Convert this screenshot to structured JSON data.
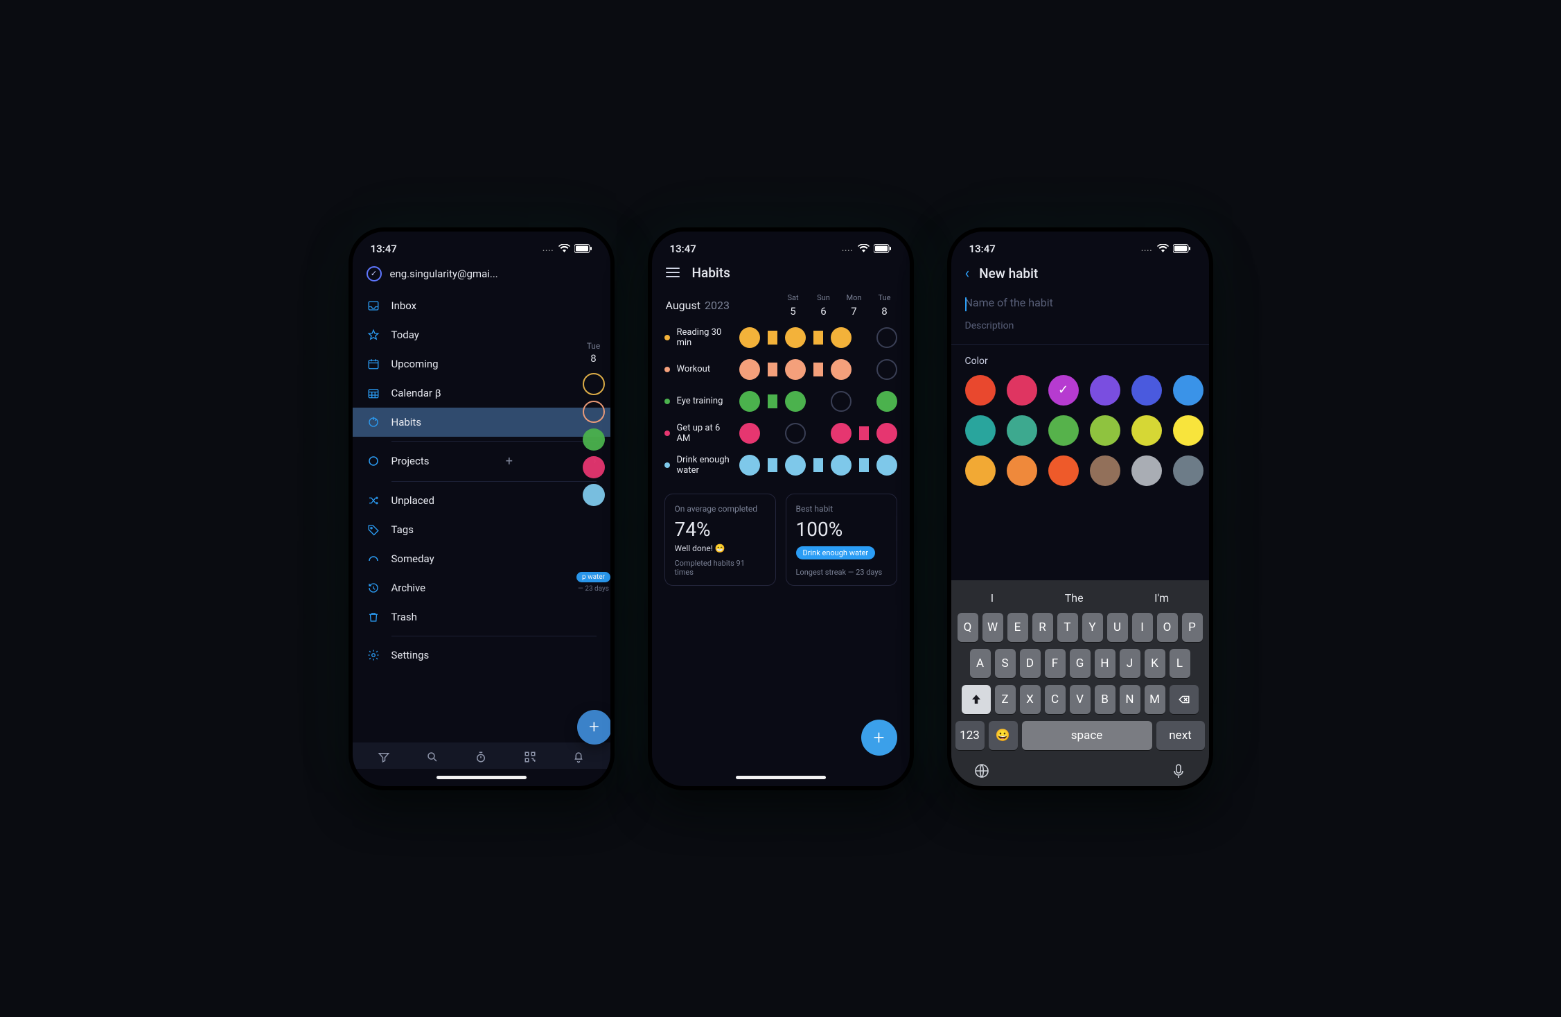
{
  "status": {
    "time": "13:47"
  },
  "sidebar": {
    "profile_email": "eng.singularity@gmai...",
    "items": [
      {
        "icon": "inbox",
        "label": "Inbox"
      },
      {
        "icon": "star",
        "label": "Today"
      },
      {
        "icon": "calendar",
        "label": "Upcoming"
      },
      {
        "icon": "calendar-grid",
        "label": "Calendar β"
      },
      {
        "icon": "target",
        "label": "Habits"
      },
      {
        "icon": "circle",
        "label": "Projects"
      },
      {
        "icon": "shuffle",
        "label": "Unplaced"
      },
      {
        "icon": "tag",
        "label": "Tags"
      },
      {
        "icon": "arc",
        "label": "Someday"
      },
      {
        "icon": "history",
        "label": "Archive"
      },
      {
        "icon": "trash",
        "label": "Trash"
      },
      {
        "icon": "gear",
        "label": "Settings"
      }
    ],
    "selected_index": 4,
    "peek": {
      "day_name": "Tue",
      "day_num": "8",
      "pill": "p water",
      "streak": "— 23 days"
    }
  },
  "habits": {
    "title": "Habits",
    "month": "August",
    "year": "2023",
    "days": [
      {
        "name": "Sat",
        "num": "5"
      },
      {
        "name": "Sun",
        "num": "6"
      },
      {
        "name": "Mon",
        "num": "7"
      },
      {
        "name": "Tue",
        "num": "8"
      }
    ],
    "rows": [
      {
        "name": "Reading 30 min",
        "color": "#f3b23a",
        "cells": [
          "fill",
          "fill",
          "fill",
          "empty"
        ],
        "links": [
          true,
          true,
          false
        ]
      },
      {
        "name": "Workout",
        "color": "#f4a07b",
        "cells": [
          "fill",
          "fill",
          "fill",
          "empty"
        ],
        "links": [
          true,
          true,
          false
        ]
      },
      {
        "name": "Eye training",
        "color": "#4bb24d",
        "cells": [
          "fill",
          "fill",
          "empty",
          "fill"
        ],
        "links": [
          true,
          false,
          false
        ]
      },
      {
        "name": "Get up at 6 AM",
        "color": "#e63670",
        "cells": [
          "fill",
          "empty",
          "fill",
          "fill"
        ],
        "links": [
          false,
          false,
          true
        ]
      },
      {
        "name": "Drink enough water",
        "color": "#7ec8ea",
        "cells": [
          "fill",
          "fill",
          "fill",
          "fill"
        ],
        "links": [
          true,
          true,
          true
        ],
        "wave": true
      }
    ],
    "stats": {
      "avg": {
        "label": "On average completed",
        "value": "74%",
        "note": "Well done! 😁",
        "foot": "Completed habits 91 times"
      },
      "best": {
        "label": "Best habit",
        "value": "100%",
        "chip": "Drink enough water",
        "foot": "Longest streak — 23 days"
      }
    }
  },
  "new_habit": {
    "title": "New habit",
    "name_placeholder": "Name of the habit",
    "description_label": "Description",
    "color_label": "Color",
    "colors": [
      "#e9482e",
      "#df3561",
      "#b63bd0",
      "#7a4ee0",
      "#4a5ade",
      "#3a93e8",
      "#29a59d",
      "#3da98f",
      "#56b24b",
      "#8fc33f",
      "#d6d735",
      "#f8e43c",
      "#f2a934",
      "#ef893b",
      "#ee5a2a",
      "#92705a",
      "#a9adb4",
      "#6d7c88"
    ],
    "selected_color_index": 2
  },
  "keyboard": {
    "suggestions": [
      "I",
      "The",
      "I'm"
    ],
    "row1": [
      "Q",
      "W",
      "E",
      "R",
      "T",
      "Y",
      "U",
      "I",
      "O",
      "P"
    ],
    "row2": [
      "A",
      "S",
      "D",
      "F",
      "G",
      "H",
      "J",
      "K",
      "L"
    ],
    "row3": [
      "Z",
      "X",
      "C",
      "V",
      "B",
      "N",
      "M"
    ],
    "numbers_key": "123",
    "space_key": "space",
    "next_key": "next"
  }
}
